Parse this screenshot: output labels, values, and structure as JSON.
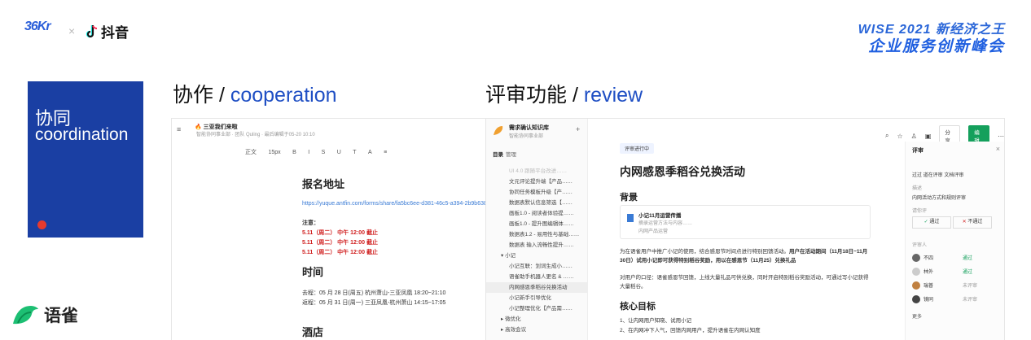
{
  "header": {
    "logo_36kr": "36Kr",
    "times": "×",
    "douyin": "抖音",
    "wise_line1": "WISE 2021 新经济之王",
    "wise_line2": "企业服务创新峰会"
  },
  "card": {
    "title_cn": "协同",
    "title_en": "coordination"
  },
  "brand": {
    "yuque": "语雀"
  },
  "section_left": {
    "cn": "协作 / ",
    "en": "cooperation"
  },
  "section_right": {
    "cn": "评审功能 / ",
    "en": "review"
  },
  "doc_left": {
    "title": "三亚我们来啦",
    "subtitle": "智能协同事业部 · 团队 Quling · 最后编辑于05-20 10:10",
    "toolbar": [
      "正文",
      "15px",
      "B",
      "I",
      "S",
      "U",
      "T",
      "A",
      "≡"
    ],
    "h1": "报名地址",
    "url": "https://yuque.antfin.com/forms/share/fa5bc6ee-d381-46c5-a394-2b9b638",
    "note_label": "注意：",
    "red_lines": [
      "5.11（周二） 中午 12:00 截止",
      "5.11（周二） 中午 12:00 截止",
      "5.11（周二） 中午 12:00 截止"
    ],
    "h2": "时间",
    "time_lines": [
      "去程：05 月 28 日(周五) 杭州萧山-三亚凤凰 18:20~21:10",
      "返程：05 月 31 日(周一) 三亚凤凰-杭州萧山 14:15~17:05"
    ],
    "h3": "酒店"
  },
  "doc_right": {
    "kb_title": "需求确认知识库",
    "kb_sub": "智能协同事业部",
    "tab_dir": "目录",
    "tab_manage": "管理",
    "sidebar_items": [
      "UI 4.0 跟随平台改进……",
      "文元评论提升端【产品……",
      "协同任务模板升级【产……",
      "数据表默认信息筛选【……",
      "画板1.0 - 阅读者体验提……",
      "画板1.0 - 提升图编辑体……",
      "数据表1.2 - 易用性与基础……",
      "数据表 输入流畅性提升……",
      "小记",
      "小记互联：划词生成小……",
      "语雀助手机器人更名 & ……",
      "内网感恩季稻谷兑换活动",
      "小记新手引导优化",
      "小记整理优化【产品需……",
      "微优化",
      "高效会议"
    ],
    "status_tag": "评审进行中",
    "doc_title": "内网感恩季稻谷兑换活动",
    "section_bg": "背景",
    "card_title": "小记11月运营传播",
    "card_desc": "摘录运营方法与内容……",
    "card_sub": "内网产品运营",
    "para1": "为在语雀用户中推广小记的使用，结合感恩节时间点进行特别回馈活动。",
    "para1_hl": "用户在活动期间（11月18日~11月30日）试用小记即可获得特别稻谷奖励，用以在感恩节（11月25）兑换礼品",
    "para2": "对用户的口径：语雀感恩节回馈，上线大量礼品可供兑换，同时开启特别稻谷奖励活动，可通过写小记获得大量稻谷。",
    "section_goal": "核心目标",
    "goal1": "1、让内网用户知晓、试用小记",
    "goal2": "2、在内网冲下人气，回馈内网用户，提升语雀在内网认知度",
    "btn_share": "分享",
    "btn_edit": "编辑",
    "review_panel_title": "评审",
    "review_summary": "过过 道在评审 文档评审",
    "review_desc_label": "描述",
    "review_desc": "内网活动方式和规则评审",
    "review_opinion": "请你评",
    "btn_pass": "通过",
    "btn_reject": "不通过",
    "reviewers_label": "评审人",
    "reviewers": [
      {
        "name": "不四",
        "status": "通过"
      },
      {
        "name": "林外",
        "status": "通过"
      },
      {
        "name": "瑞普",
        "status": "未评审"
      },
      {
        "name": "镜同",
        "status": "未评审"
      }
    ],
    "more": "更多"
  },
  "colors": {
    "brand_blue": "#1a3fa3",
    "green": "#14a05c",
    "red": "#d02020"
  }
}
